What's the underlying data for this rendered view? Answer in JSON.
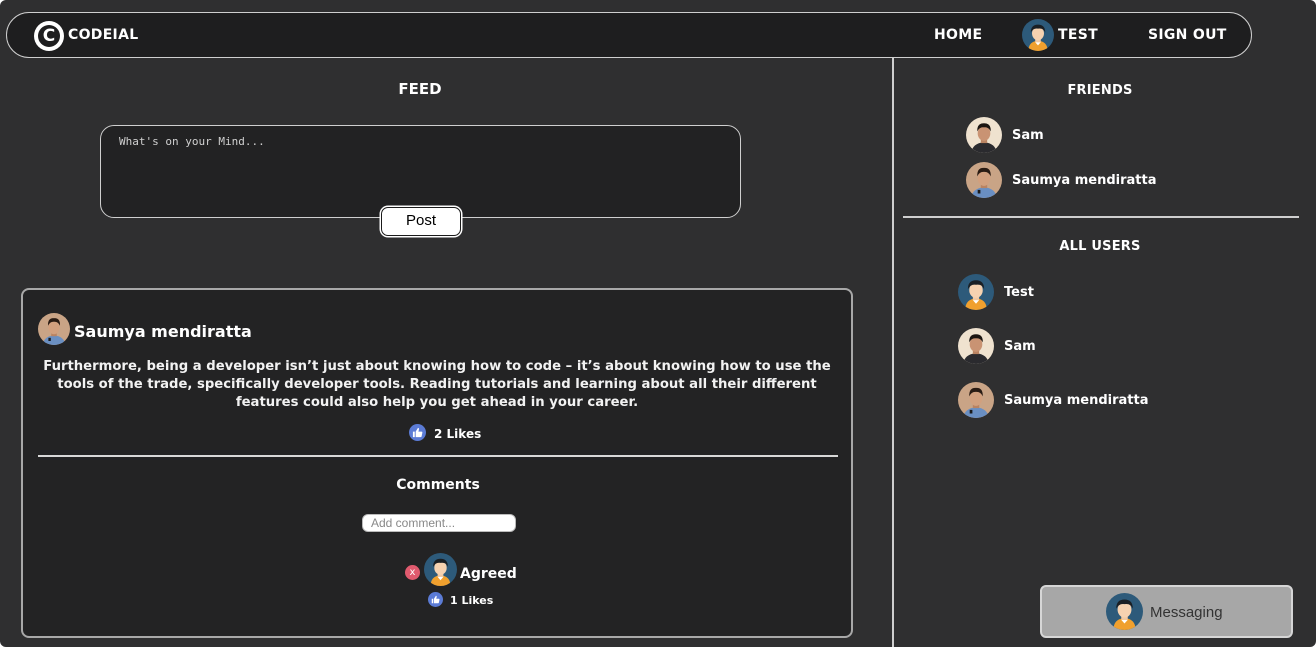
{
  "navbar": {
    "logo_letter": "C",
    "brand": "CODEIAL",
    "home_label": "HOME",
    "profile_label": "TEST",
    "signout_label": "SIGN OUT"
  },
  "feed": {
    "title": "FEED",
    "composer_placeholder": "What's on your Mind...",
    "post_button": "Post"
  },
  "post": {
    "author": "Saumya mendiratta",
    "body": "Furthermore, being a developer isn’t just about knowing how to code – it’s about knowing how to use the tools of the trade, specifically developer tools. Reading tutorials and learning about all their different features could also help you get ahead in your career.",
    "likes": "2 Likes",
    "comments_title": "Comments",
    "comment_placeholder": "Add comment...",
    "comments": [
      {
        "text": "Agreed",
        "likes": "1 Likes",
        "delete_icon": "x"
      }
    ]
  },
  "sidebar": {
    "friends_title": "FRIENDS",
    "friends": [
      {
        "name": "Sam"
      },
      {
        "name": "Saumya mendiratta"
      }
    ],
    "users_title": "ALL USERS",
    "users": [
      {
        "name": "Test"
      },
      {
        "name": "Sam"
      },
      {
        "name": "Saumya mendiratta"
      }
    ]
  },
  "messaging": {
    "label": "Messaging"
  },
  "colors": {
    "background": "#2f2f30",
    "navbar": "#1e1e1f",
    "like_blue": "#5b7bd5",
    "delete_red": "#e05a6e",
    "messaging_bg": "#a7a7a7"
  }
}
